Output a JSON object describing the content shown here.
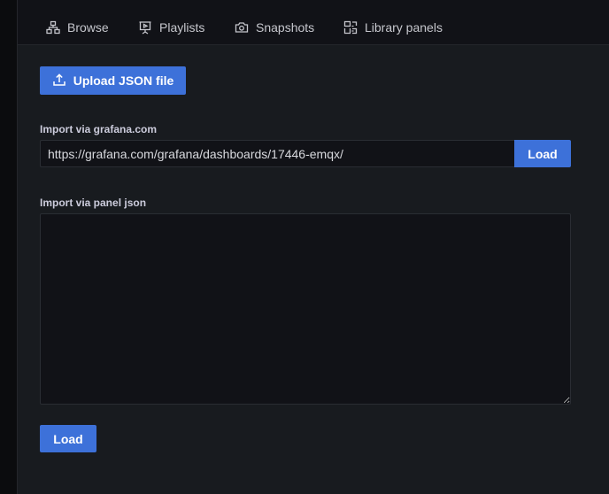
{
  "tabs": [
    {
      "label": "Browse",
      "icon": "sitemap-icon"
    },
    {
      "label": "Playlists",
      "icon": "presentation-icon"
    },
    {
      "label": "Snapshots",
      "icon": "camera-icon"
    },
    {
      "label": "Library panels",
      "icon": "library-panel-icon"
    }
  ],
  "upload": {
    "label": "Upload JSON file",
    "icon": "upload-icon"
  },
  "grafana_import": {
    "label": "Import via grafana.com",
    "value": "https://grafana.com/grafana/dashboards/17446-emqx/",
    "button": "Load"
  },
  "panel_json": {
    "label": "Import via panel json",
    "value": "",
    "button": "Load"
  },
  "colors": {
    "primary": "#3d71d9",
    "background": "#111217",
    "panel": "#181b1f"
  }
}
